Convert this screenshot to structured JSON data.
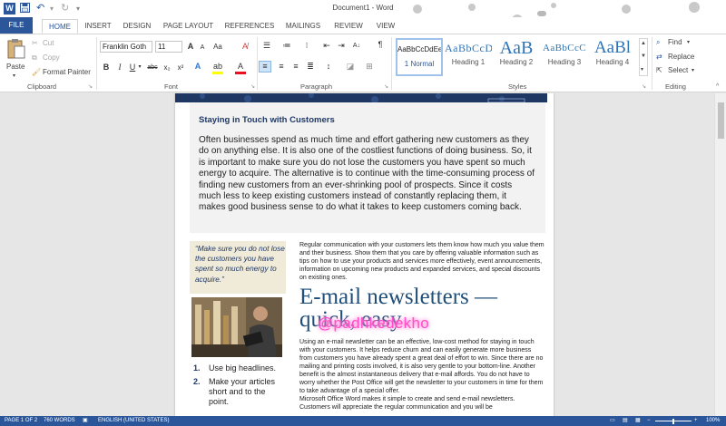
{
  "titlebar": {
    "app_icon": "W",
    "document_title": "Document1 - Word"
  },
  "tabs": [
    "FILE",
    "HOME",
    "INSERT",
    "DESIGN",
    "PAGE LAYOUT",
    "REFERENCES",
    "MAILINGS",
    "REVIEW",
    "VIEW"
  ],
  "clipboard": {
    "paste": "Paste",
    "cut": "Cut",
    "copy": "Copy",
    "format_painter": "Format Painter",
    "label": "Clipboard"
  },
  "font": {
    "name": "Franklin Goth",
    "size": "11",
    "label": "Font",
    "bold": "B",
    "italic": "I",
    "underline": "U",
    "strike": "abc",
    "subscript": "x₂",
    "superscript": "x²",
    "grow": "A",
    "shrink": "A",
    "case": "Aa"
  },
  "paragraph": {
    "label": "Paragraph",
    "show_marks": "¶"
  },
  "styles": {
    "label": "Styles",
    "items": [
      {
        "sample": "AaBbCcDdEe",
        "name": "1 Normal"
      },
      {
        "sample": "AaBbCcD",
        "name": "Heading 1"
      },
      {
        "sample": "AaB",
        "name": "Heading 2"
      },
      {
        "sample": "AaBbCcC",
        "name": "Heading 3"
      },
      {
        "sample": "AaBl",
        "name": "Heading 4"
      }
    ]
  },
  "editing": {
    "find": "Find",
    "replace": "Replace",
    "select": "Select",
    "label": "Editing"
  },
  "document": {
    "section_heading": "Staying in Touch with Customers",
    "intro": "Often businesses spend as much time and effort gathering new customers as they do on anything else. It is also one of the costliest functions of doing business. So, it is important to make sure you do not lose the customers you have spent so much energy to acquire. The alternative is to continue with the time-consuming process of finding new customers from an ever-shrinking pool of prospects. Since it costs much less to keep existing customers instead of constantly replacing them, it makes good business sense to do what it takes to keep customers coming back.",
    "quote": "“Make sure you do not lose the customers you have spent so much energy to acquire.”",
    "para1": "Regular communication with your customers lets them know how much you value them and their business. Show them that you care by offering valuable information such as tips on how to use your products and services more effectively, event announcements, information on upcoming new products and expanded services, and special discounts on existing ones.",
    "big_heading": "E-mail newsletters — quick, easy",
    "para2": "Using an e-mail newsletter can be an effective, low-cost method for staying in touch with your customers. It helps reduce churn and can easily generate more business from customers you have already spent a great deal of effort to win. Since there are no mailing and printing costs involved, it is also very gentle to your bottom-line. Another benefit is the almost instantaneous delivery that e-mail affords. You do not have to worry whether the Post Office will get the newsletter to your customers in time for them to take advantage of a special offer.",
    "para3": "Microsoft Office Word makes it simple to create and send e-mail newsletters. Customers will appreciate the regular communication and you will be",
    "list": [
      {
        "num": "1.",
        "text": "Use big headlines."
      },
      {
        "num": "2.",
        "text": "Make your articles short and to the point."
      }
    ]
  },
  "watermark": "@padhkedekho",
  "status": {
    "page": "PAGE 1 OF 2",
    "words": "760 WORDS",
    "language": "ENGLISH (UNITED STATES)",
    "zoom": "100%"
  }
}
